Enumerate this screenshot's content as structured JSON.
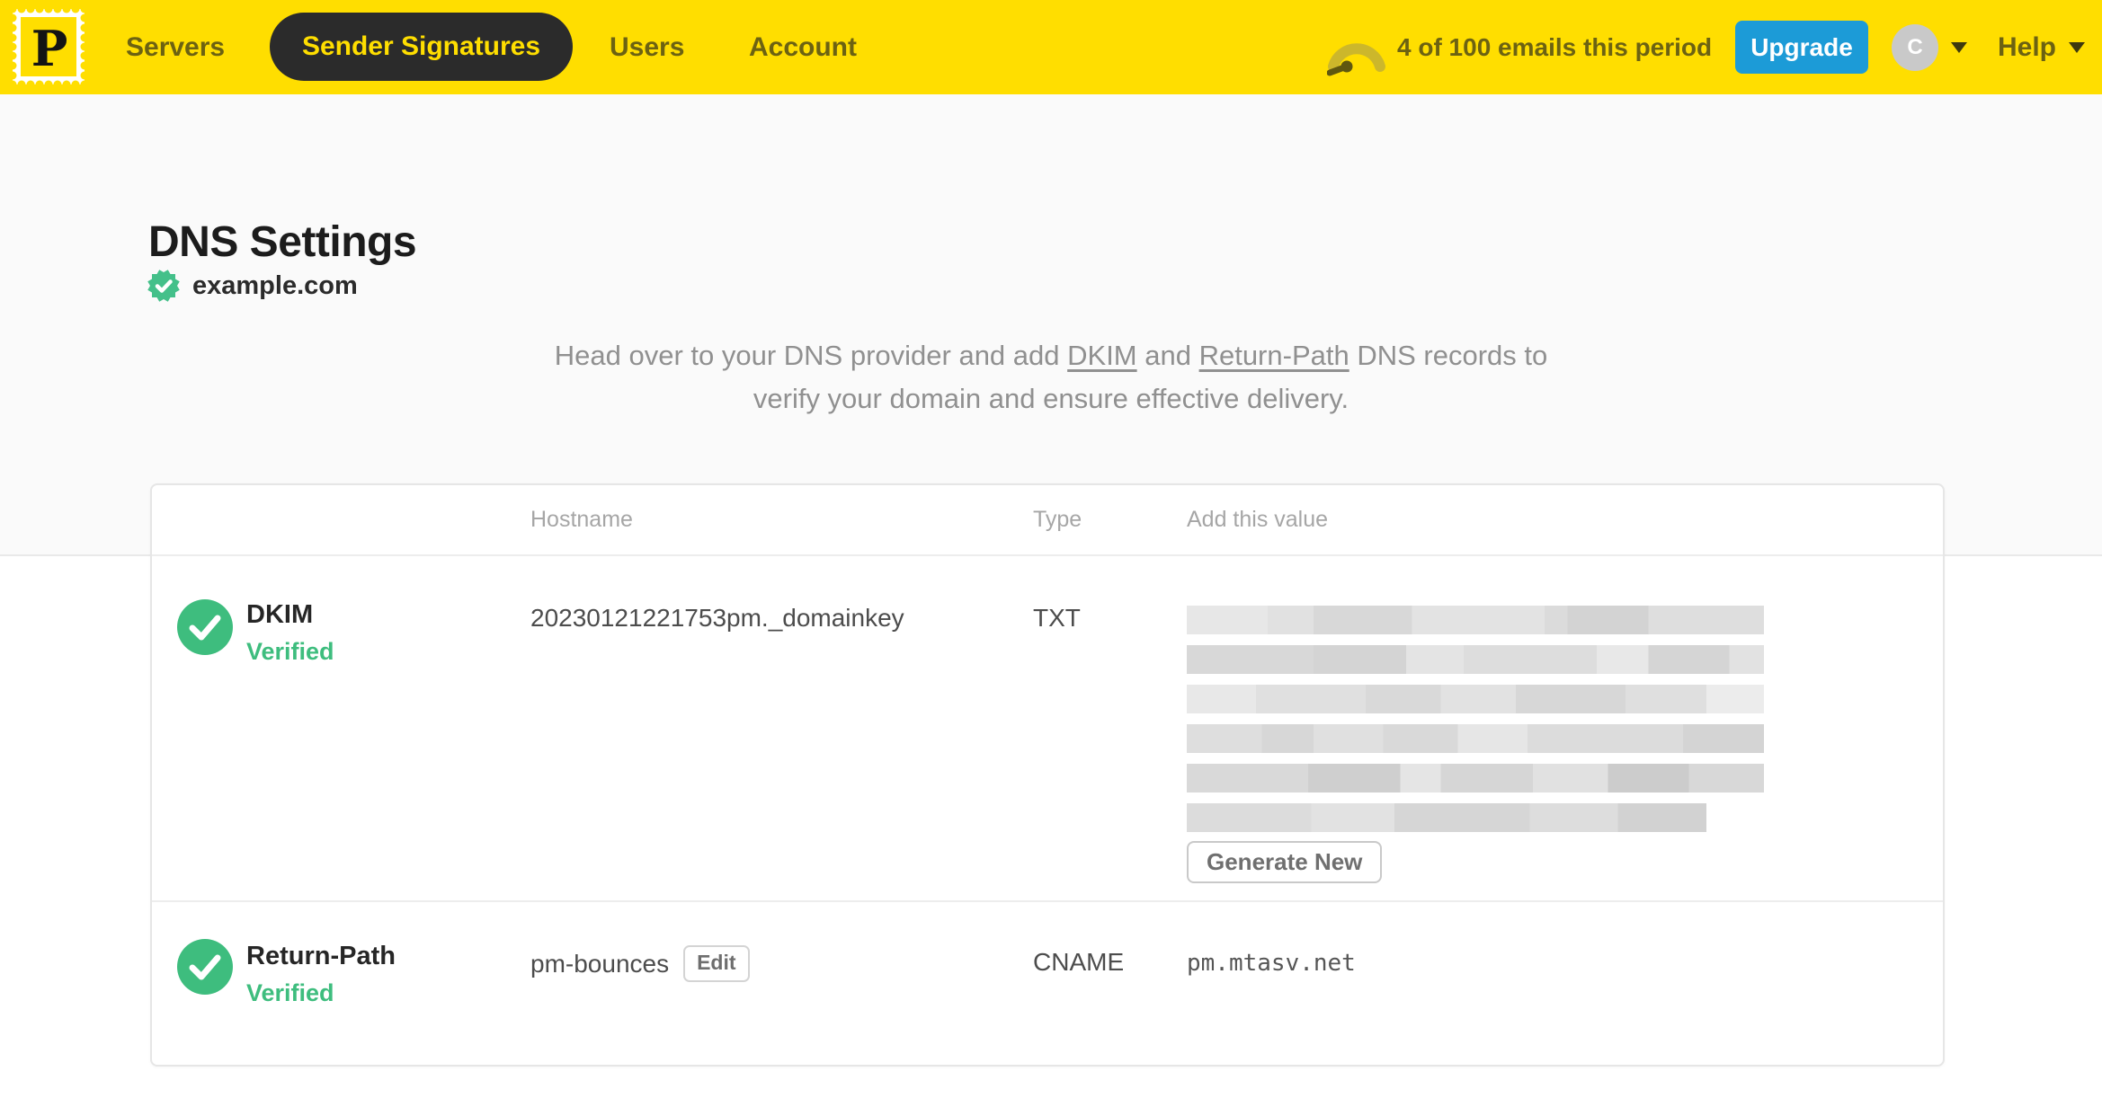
{
  "nav": {
    "logo_icon": "postmark-stamp-logo",
    "items": [
      {
        "label": "Servers",
        "active": false
      },
      {
        "label": "Sender Signatures",
        "active": true
      },
      {
        "label": "Users",
        "active": false
      },
      {
        "label": "Account",
        "active": false
      }
    ],
    "usage_icon": "gauge-icon",
    "usage_text": "4 of 100 emails this period",
    "upgrade_label": "Upgrade",
    "avatar_initial": "C",
    "help_label": "Help"
  },
  "page": {
    "title": "DNS Settings",
    "domain": "example.com",
    "domain_status_icon": "verified-seal-icon",
    "description": {
      "pre": "Head over to your DNS provider and add ",
      "link_dkim": "DKIM",
      "mid": " and ",
      "link_return_path": "Return-Path",
      "post": " DNS records to",
      "line2": "verify your domain and ensure effective delivery."
    }
  },
  "table": {
    "headers": {
      "hostname": "Hostname",
      "type": "Type",
      "value": "Add this value"
    },
    "rows": [
      {
        "name": "DKIM",
        "status": "Verified",
        "hostname": "20230121221753pm._domainkey",
        "type": "TXT",
        "value": "[redacted]",
        "action_label": "Generate New"
      },
      {
        "name": "Return-Path",
        "status": "Verified",
        "hostname": "pm-bounces",
        "edit_label": "Edit",
        "type": "CNAME",
        "value": "pm.mtasv.net"
      }
    ],
    "redaction": {
      "bar_count": 6,
      "bar_widths_pct": [
        100,
        100,
        100,
        100,
        100,
        90
      ]
    }
  },
  "colors": {
    "brand_yellow": "#FFDE00",
    "nav_text": "#6C6212",
    "nav_active_bg": "#2B2B2B",
    "upgrade_blue": "#1C9BD7",
    "verified_green": "#3EBD7E",
    "title_text": "#1C1C1C",
    "muted_text": "#909090",
    "table_header_text": "#A6A6A6"
  }
}
